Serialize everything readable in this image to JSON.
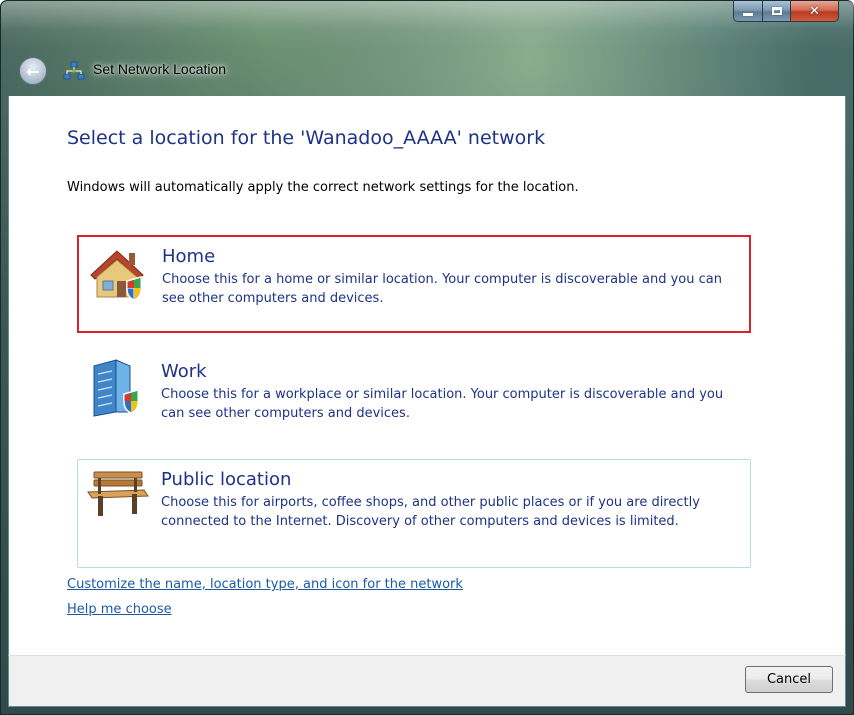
{
  "window": {
    "title": "Set Network Location",
    "caption_buttons": {
      "minimize": "minimize-icon",
      "maximize": "maximize-icon",
      "close": "✕"
    }
  },
  "main": {
    "heading": "Select a location for the 'Wanadoo_AAAA' network",
    "subtext": "Windows will automatically apply the correct network settings for the location.",
    "options": [
      {
        "title": "Home",
        "description": "Choose this for a home or similar location. Your computer is discoverable and you can see other computers and devices.",
        "icon": "house-icon",
        "selected": true
      },
      {
        "title": "Work",
        "description": "Choose this for a workplace or similar location. Your computer is discoverable and you can see other computers and devices.",
        "icon": "office-building-icon",
        "selected": false
      },
      {
        "title": "Public location",
        "description": "Choose this for airports, coffee shops, and other public places or if you are directly connected to the Internet. Discovery of other computers and devices is limited.",
        "icon": "park-bench-icon",
        "selected": false
      }
    ],
    "links": {
      "customize": "Customize the name, location type, and icon for the network",
      "help": "Help me choose"
    }
  },
  "footer": {
    "cancel_label": "Cancel"
  },
  "colors": {
    "heading": "#1e3287",
    "link": "#1a5ba6",
    "selection_border": "#d6232a",
    "public_border": "#b6dbea"
  }
}
